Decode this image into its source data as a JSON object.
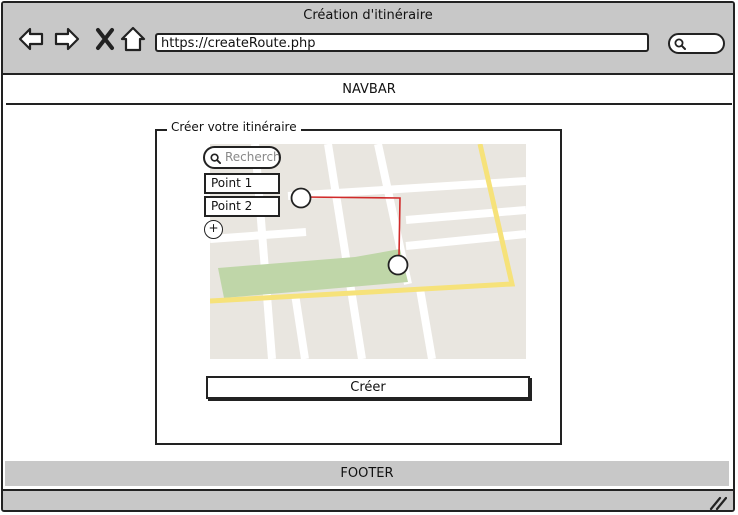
{
  "window": {
    "title": "Création d'itinéraire"
  },
  "browser": {
    "url": "https://createRoute.php",
    "icons": [
      "back-icon",
      "forward-icon",
      "close-icon",
      "home-icon",
      "search-icon"
    ]
  },
  "navbar": {
    "label": "NAVBAR"
  },
  "panel": {
    "legend": "Créer votre itinéraire",
    "search_placeholder": "Recherche",
    "points": [
      "Point 1",
      "Point 2"
    ],
    "add_label": "+",
    "create_label": "Créer"
  },
  "footer": {
    "label": "FOOTER"
  },
  "colors": {
    "chrome": "#c8c8c8",
    "map_background": "#e9e6e0",
    "map_road": "#ffffff",
    "map_highway": "#f6e27a",
    "map_park": "#bfd6a8",
    "route": "#d12a2a"
  }
}
